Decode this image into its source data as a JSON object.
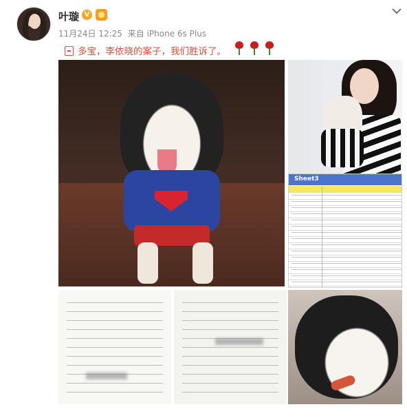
{
  "post": {
    "username": "叶璇",
    "verified_badge": "V",
    "timestamp": "11月24日 12:25",
    "source": "来自 iPhone 6s Plus",
    "text": "多宝，李依晓的案子，我们胜诉了。",
    "emoji_count": 3,
    "emoji_name": "rose-icon"
  },
  "images": [
    {
      "name": "photo-dog-superman-costume"
    },
    {
      "name": "photo-woman-with-dog"
    },
    {
      "name": "photo-spreadsheet"
    },
    {
      "name": "photo-document-page-1"
    },
    {
      "name": "photo-document-page-2"
    },
    {
      "name": "photo-dog-eating"
    }
  ],
  "spreadsheet": {
    "tab_label": "Sheet3"
  },
  "colors": {
    "text_accent": "#e14b3b",
    "meta_gray": "#888888",
    "badge": "#f6a623"
  }
}
